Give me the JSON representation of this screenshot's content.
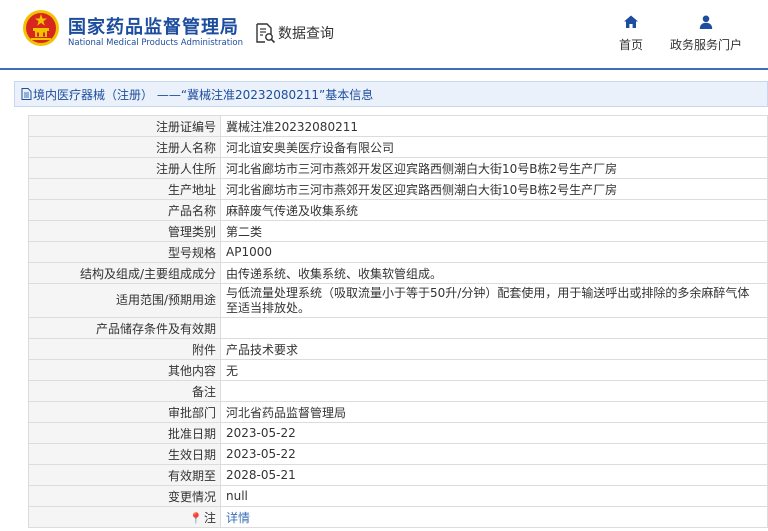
{
  "header": {
    "title_cn": "国家药品监督管理局",
    "title_en": "National Medical Products Administration",
    "query_label": "数据查询",
    "nav": [
      {
        "label": "首页",
        "icon": "home-icon"
      },
      {
        "label": "政务服务门户",
        "icon": "user-icon"
      }
    ]
  },
  "breadcrumb": {
    "text": "境内医疗器械（注册） ——“冀械注准20232080211”基本信息"
  },
  "colors": {
    "brand_blue": "#1d4d9e",
    "link_blue": "#3b6fb6",
    "emblem_red": "#d7261e",
    "emblem_gold": "#f2c200"
  },
  "rows": [
    {
      "label": "注册证编号",
      "value": "冀械注准20232080211"
    },
    {
      "label": "注册人名称",
      "value": "河北谊安奥美医疗设备有限公司"
    },
    {
      "label": "注册人住所",
      "value": "河北省廊坊市三河市燕郊开发区迎宾路西侧潮白大街10号B栋2号生产厂房"
    },
    {
      "label": "生产地址",
      "value": "河北省廊坊市三河市燕郊开发区迎宾路西侧潮白大街10号B栋2号生产厂房"
    },
    {
      "label": "产品名称",
      "value": "麻醉废气传递及收集系统"
    },
    {
      "label": "管理类别",
      "value": "第二类"
    },
    {
      "label": "型号规格",
      "value": "AP1000"
    },
    {
      "label": "结构及组成/主要组成成分",
      "value": "由传递系统、收集系统、收集软管组成。"
    },
    {
      "label": "适用范围/预期用途",
      "value": "与低流量处理系统（吸取流量小于等于50升/分钟）配套使用，用于输送呼出或排除的多余麻醉气体至适当排放处。"
    },
    {
      "label": "产品储存条件及有效期",
      "value": ""
    },
    {
      "label": "附件",
      "value": "产品技术要求"
    },
    {
      "label": "其他内容",
      "value": "无"
    },
    {
      "label": "备注",
      "value": ""
    },
    {
      "label": "审批部门",
      "value": "河北省药品监督管理局"
    },
    {
      "label": "批准日期",
      "value": "2023-05-22"
    },
    {
      "label": "生效日期",
      "value": "2023-05-22"
    },
    {
      "label": "有效期至",
      "value": "2028-05-21"
    },
    {
      "label": "变更情况",
      "value": "null"
    },
    {
      "label": "注",
      "value": "详情"
    }
  ]
}
